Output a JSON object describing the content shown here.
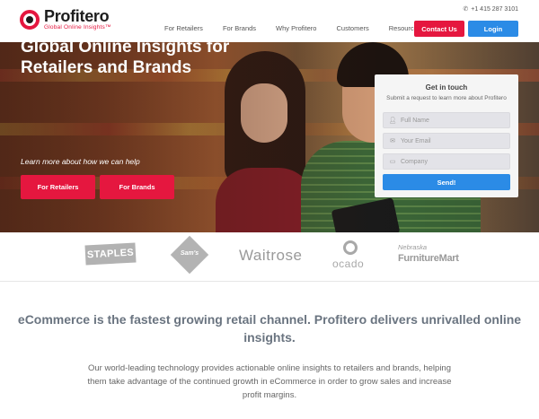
{
  "brand": {
    "name": "Profitero",
    "tagline": "Global Online Insights™"
  },
  "header": {
    "phone": "+1 415 287 3101",
    "nav": [
      "For Retailers",
      "For Brands",
      "Why Profitero",
      "Customers",
      "Resources"
    ],
    "contact_label": "Contact Us",
    "login_label": "Login"
  },
  "hero": {
    "title": "Global Online Insights for Retailers and Brands",
    "subtitle": "Learn more about how we can help",
    "btn_retailers": "For Retailers",
    "btn_brands": "For Brands"
  },
  "form": {
    "title": "Get in touch",
    "subtitle": "Submit a request to learn more about Profitero",
    "full_name_placeholder": "Full Name",
    "email_placeholder": "Your Email",
    "company_placeholder": "Company",
    "send_label": "Send!"
  },
  "clients": {
    "staples": "STAPLES",
    "sams": "Sam's",
    "waitrose": "Waitrose",
    "ocado": "ocado",
    "nebraska": "Nebraska",
    "furniture_mart": "FurnitureMart"
  },
  "content": {
    "lead": "eCommerce is the fastest growing retail channel. Profitero delivers unrivalled online insights.",
    "body": "Our world-leading technology provides actionable online insights to retailers and brands, helping them take advantage of the continued growth in eCommerce in order to grow sales and increase profit margins."
  },
  "colors": {
    "accent_red": "#e5173f",
    "accent_blue": "#2b8be6"
  }
}
